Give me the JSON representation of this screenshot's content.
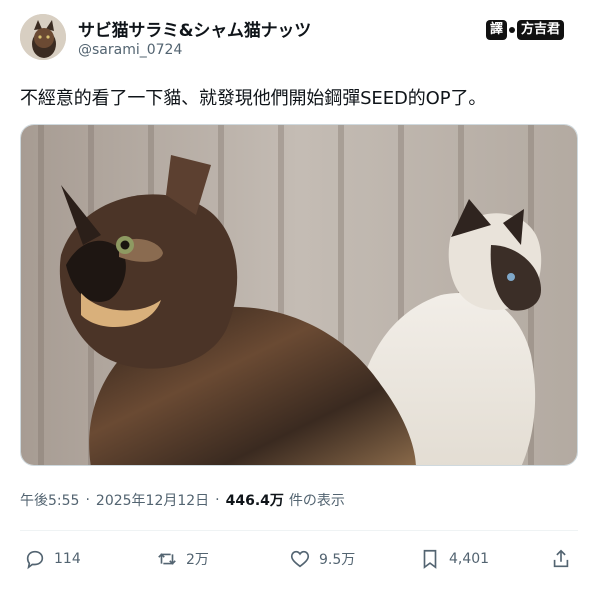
{
  "author": {
    "display_name": "サビ猫サラミ&シャム猫ナッツ",
    "handle": "@sarami_0724"
  },
  "watermark": {
    "left": "譯",
    "right": "方吉君"
  },
  "tweet": {
    "text": "不經意的看了一下貓、就發現他們開始鋼彈SEED的OP了。"
  },
  "meta": {
    "time": "午後5:55",
    "separator": "·",
    "date": "2025年12月12日",
    "views_count": "446.4万",
    "views_label": "件の表示"
  },
  "actions": {
    "replies": "114",
    "reposts": "2万",
    "likes": "9.5万",
    "bookmarks": "4,401"
  },
  "icons": {
    "reply": "reply-icon",
    "repost": "repost-icon",
    "like": "heart-icon",
    "bookmark": "bookmark-icon",
    "share": "share-icon"
  }
}
